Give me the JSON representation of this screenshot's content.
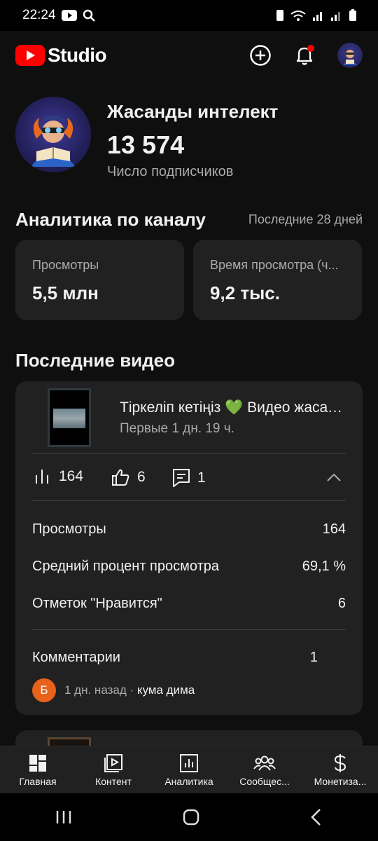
{
  "status_bar": {
    "time": "22:24"
  },
  "app_bar": {
    "logo_text": "Studio",
    "brand_color": "#ff0000"
  },
  "channel": {
    "name": "Жасанды интелект",
    "subscribers": "13 574",
    "subscribers_label": "Число подписчиков"
  },
  "analytics": {
    "title": "Аналитика по каналу",
    "period": "Последние 28 дней",
    "cards": [
      {
        "label": "Просмотры",
        "value": "5,5 млн"
      },
      {
        "label": "Время просмотра (ч...",
        "value": "9,2 тыс."
      }
    ]
  },
  "recent": {
    "title": "Последние видео",
    "video": {
      "title": "Тіркеліп кетіңіз 💚 Видео жасау...",
      "time": "Первые 1 дн. 19 ч.",
      "views": "164",
      "likes": "6",
      "comments": "1",
      "stats": [
        {
          "label": "Просмотры",
          "value": "164"
        },
        {
          "label": "Средний процент просмотра",
          "value": "69,1 %"
        },
        {
          "label": "Отметок \"Нравится\"",
          "value": "6"
        }
      ],
      "comments_label": "Комментарии",
      "comments_value": "1",
      "latest_comment": {
        "initial": "Б",
        "age": "1 дн. назад · ",
        "author": "кума дима"
      }
    }
  },
  "bottom_nav": [
    {
      "label": "Главная",
      "icon": "dashboard-icon"
    },
    {
      "label": "Контент",
      "icon": "content-icon"
    },
    {
      "label": "Аналитика",
      "icon": "analytics-icon"
    },
    {
      "label": "Сообщес...",
      "icon": "community-icon"
    },
    {
      "label": "Монетиза...",
      "icon": "dollar-icon"
    }
  ]
}
